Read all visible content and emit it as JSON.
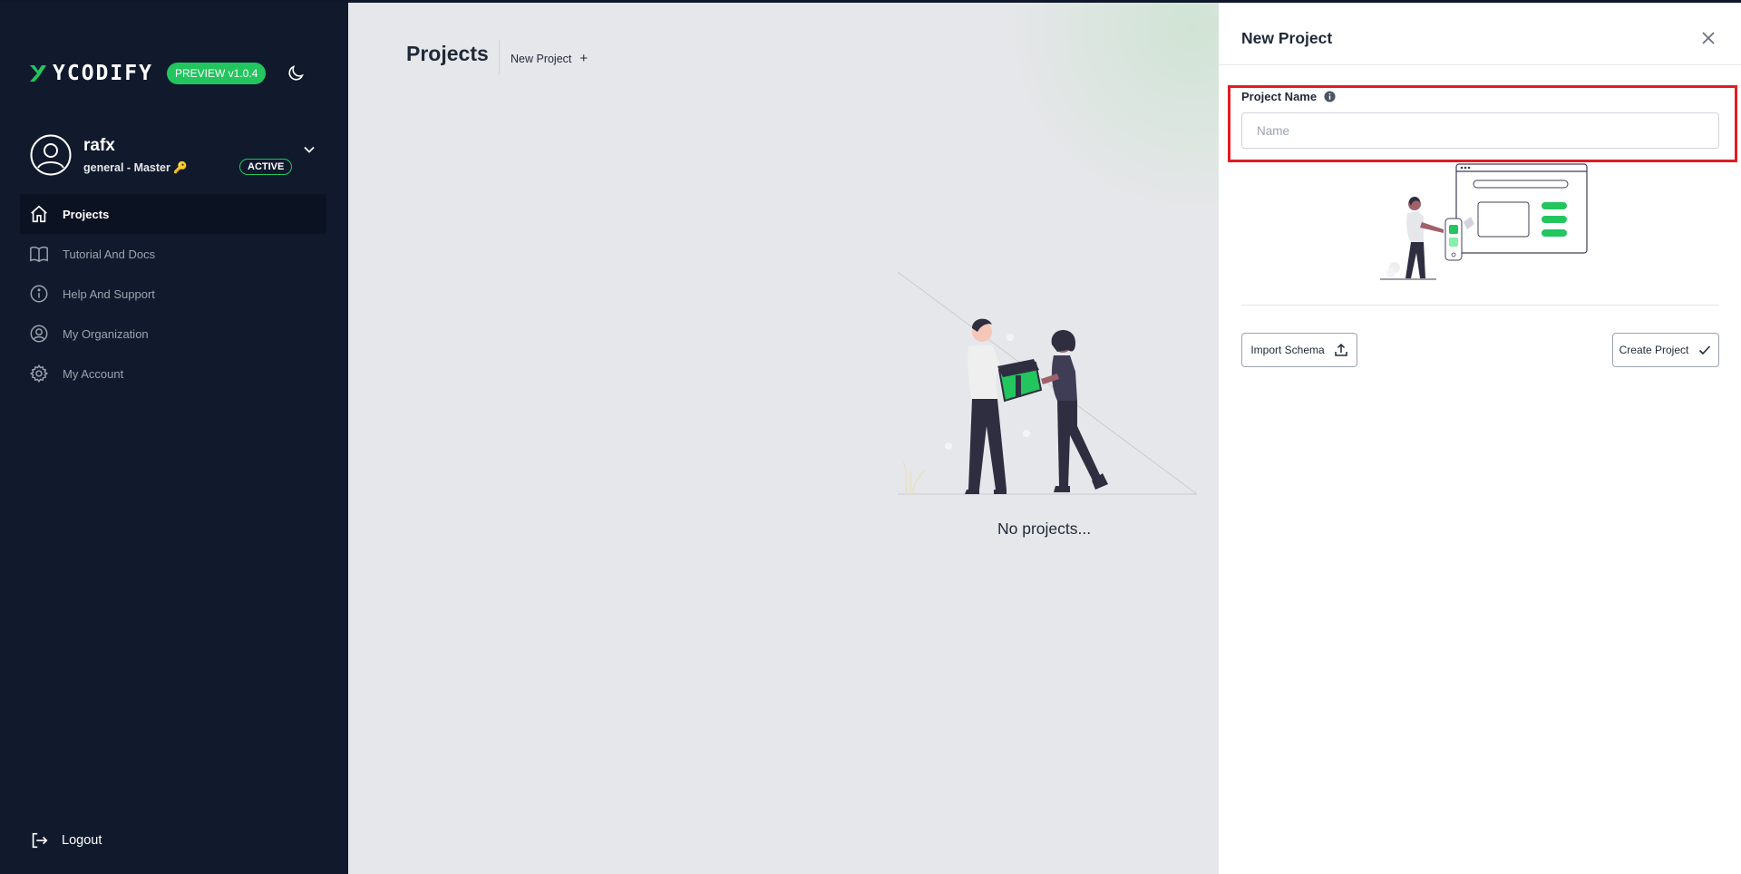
{
  "app": {
    "brand": "YCODIFY",
    "version_badge": "PREVIEW v1.0.4"
  },
  "user": {
    "name": "rafx",
    "context": "general - Master",
    "status": "ACTIVE"
  },
  "sidebar": {
    "items": [
      {
        "label": "Projects",
        "icon": "home-icon",
        "active": true
      },
      {
        "label": "Tutorial And Docs",
        "icon": "book-icon",
        "active": false
      },
      {
        "label": "Help And Support",
        "icon": "info-icon",
        "active": false
      },
      {
        "label": "My Organization",
        "icon": "user-circle-icon",
        "active": false
      },
      {
        "label": "My Account",
        "icon": "gear-icon",
        "active": false
      }
    ],
    "logout_label": "Logout"
  },
  "main": {
    "title": "Projects",
    "new_project_label": "New Project",
    "empty_text": "No projects..."
  },
  "panel": {
    "title": "New Project",
    "field_label": "Project Name",
    "name_placeholder": "Name",
    "name_value": "",
    "import_label": "Import Schema",
    "create_label": "Create Project"
  },
  "colors": {
    "sidebar_bg": "#111a2c",
    "accent_green": "#22c55e",
    "highlight_red": "#e21b23"
  }
}
